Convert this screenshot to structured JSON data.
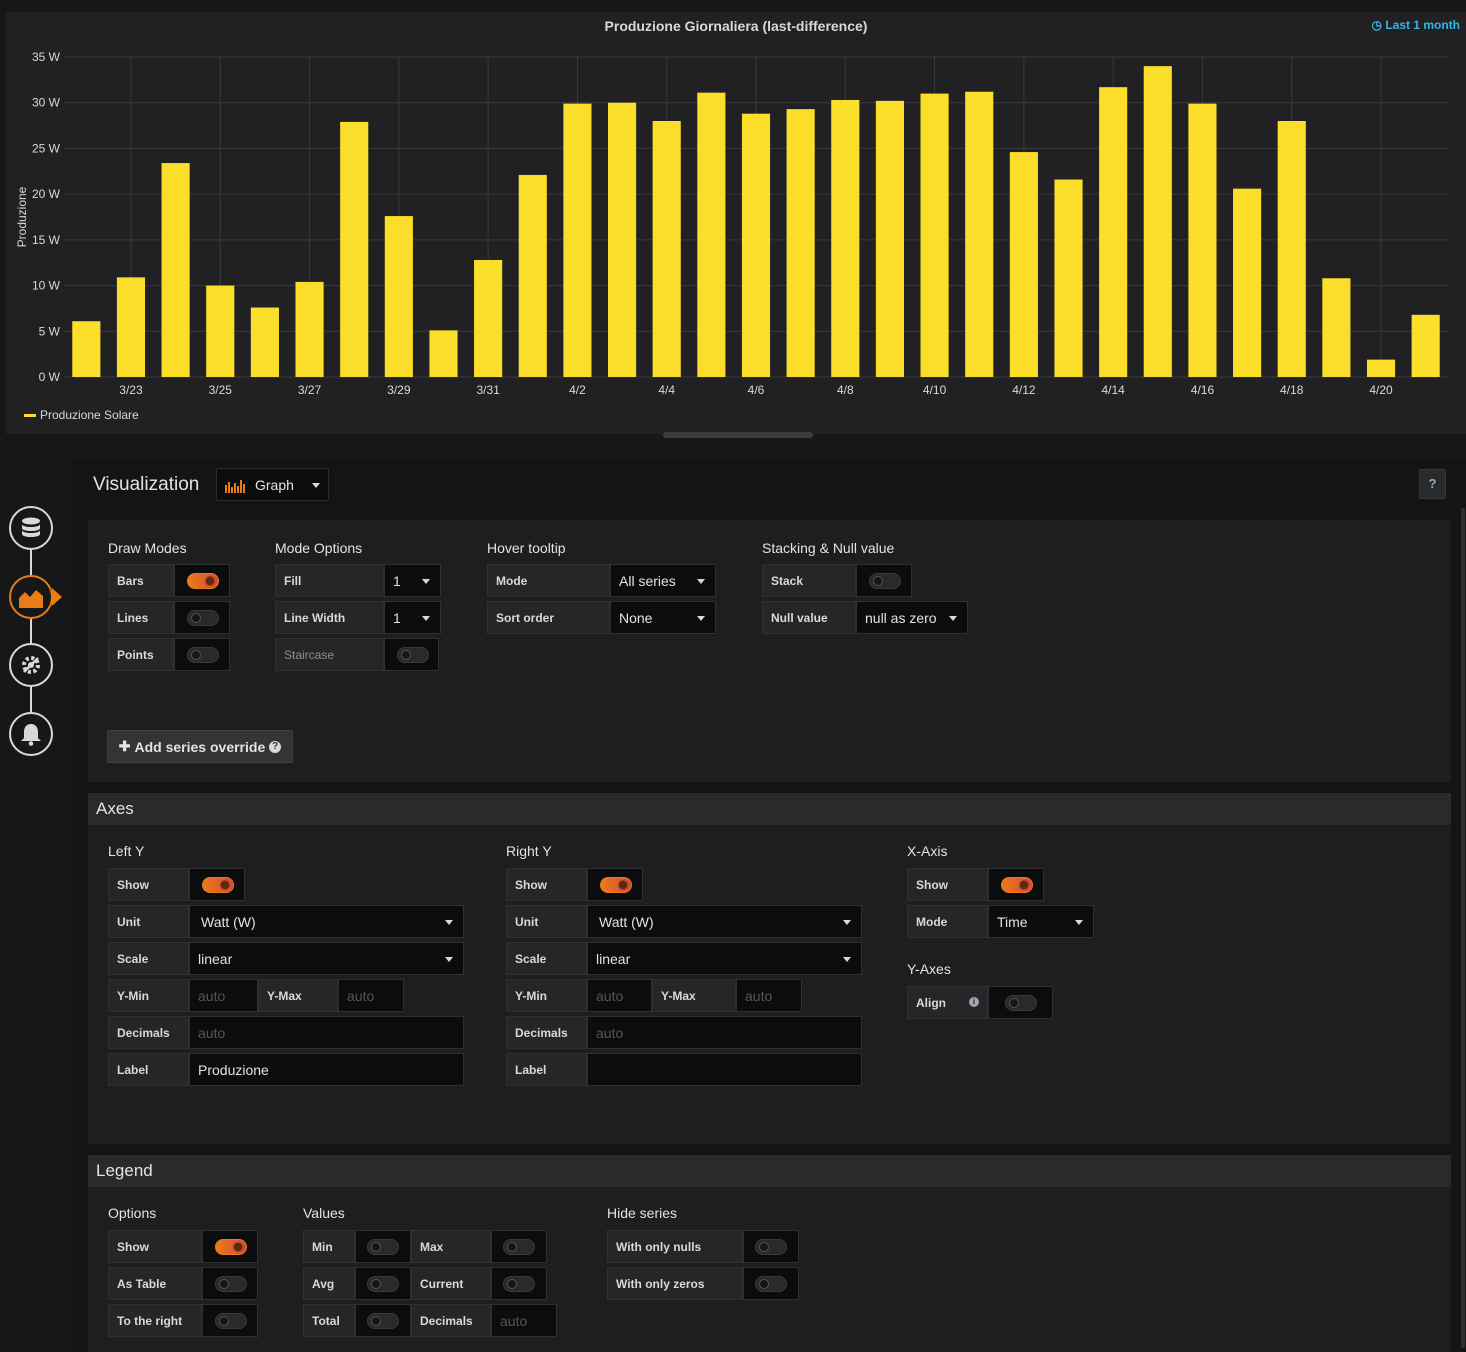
{
  "panel": {
    "title": "Produzione Giornaliera (last-difference)",
    "time_info": "Last 1 month",
    "legend_label": "Produzione Solare"
  },
  "chart_data": {
    "type": "bar",
    "title": "Produzione Giornaliera (last-difference)",
    "ylabel": "Produzione",
    "xlabel": "",
    "ylim": [
      0,
      35
    ],
    "yticks": [
      "0 W",
      "5 W",
      "10 W",
      "15 W",
      "20 W",
      "25 W",
      "30 W",
      "35 W"
    ],
    "xticks": [
      "3/23",
      "3/25",
      "3/27",
      "3/29",
      "3/31",
      "4/2",
      "4/4",
      "4/6",
      "4/8",
      "4/10",
      "4/12",
      "4/14",
      "4/16",
      "4/18",
      "4/20"
    ],
    "categories": [
      "3/22",
      "3/23",
      "3/24",
      "3/25",
      "3/26",
      "3/27",
      "3/28",
      "3/29",
      "3/30",
      "3/31",
      "4/1",
      "4/2",
      "4/3",
      "4/4",
      "4/5",
      "4/6",
      "4/7",
      "4/8",
      "4/9",
      "4/10",
      "4/11",
      "4/12",
      "4/13",
      "4/14",
      "4/15",
      "4/16",
      "4/17",
      "4/18",
      "4/19",
      "4/20",
      "4/21"
    ],
    "series": [
      {
        "name": "Produzione Solare",
        "color": "#fade2a",
        "values": [
          6.1,
          10.9,
          23.4,
          10.0,
          7.6,
          10.4,
          27.9,
          17.6,
          5.1,
          12.8,
          22.1,
          29.9,
          30.0,
          28.0,
          31.1,
          28.8,
          29.3,
          30.3,
          30.2,
          31.0,
          31.2,
          24.6,
          21.6,
          31.7,
          34.0,
          29.9,
          20.6,
          28.0,
          10.8,
          1.9,
          6.8
        ]
      }
    ],
    "grid": true,
    "legend_position": "bottom-left"
  },
  "editor": {
    "viz_label": "Visualization",
    "viz_type": "Graph",
    "help": "?",
    "draw_modes": {
      "title": "Draw Modes",
      "bars": "Bars",
      "lines": "Lines",
      "points": "Points"
    },
    "mode_options": {
      "title": "Mode Options",
      "fill": "Fill",
      "fill_val": "1",
      "line_width": "Line Width",
      "line_width_val": "1",
      "staircase": "Staircase"
    },
    "hover": {
      "title": "Hover tooltip",
      "mode": "Mode",
      "mode_val": "All series",
      "sort": "Sort order",
      "sort_val": "None"
    },
    "stacking": {
      "title": "Stacking & Null value",
      "stack": "Stack",
      "null": "Null value",
      "null_val": "null as zero"
    },
    "add_override": "Add series override",
    "axes": {
      "title": "Axes",
      "left": {
        "title": "Left Y",
        "show": "Show",
        "unit": "Unit",
        "unit_val": "Watt (W)",
        "scale": "Scale",
        "scale_val": "linear",
        "ymin": "Y-Min",
        "ymax": "Y-Max",
        "auto": "auto",
        "decimals": "Decimals",
        "label": "Label",
        "label_val": "Produzione"
      },
      "right": {
        "title": "Right Y",
        "show": "Show",
        "unit": "Unit",
        "unit_val": "Watt (W)",
        "scale": "Scale",
        "scale_val": "linear",
        "ymin": "Y-Min",
        "ymax": "Y-Max",
        "auto": "auto",
        "decimals": "Decimals",
        "label": "Label"
      },
      "xaxis": {
        "title": "X-Axis",
        "show": "Show",
        "mode": "Mode",
        "mode_val": "Time"
      },
      "yaxes": {
        "title": "Y-Axes",
        "align": "Align"
      }
    },
    "legend": {
      "title": "Legend",
      "options": {
        "title": "Options",
        "show": "Show",
        "as_table": "As Table",
        "to_right": "To the right"
      },
      "values": {
        "title": "Values",
        "min": "Min",
        "max": "Max",
        "avg": "Avg",
        "current": "Current",
        "total": "Total",
        "decimals": "Decimals",
        "auto": "auto"
      },
      "hide": {
        "title": "Hide series",
        "nulls": "With only nulls",
        "zeros": "With only zeros"
      }
    }
  }
}
